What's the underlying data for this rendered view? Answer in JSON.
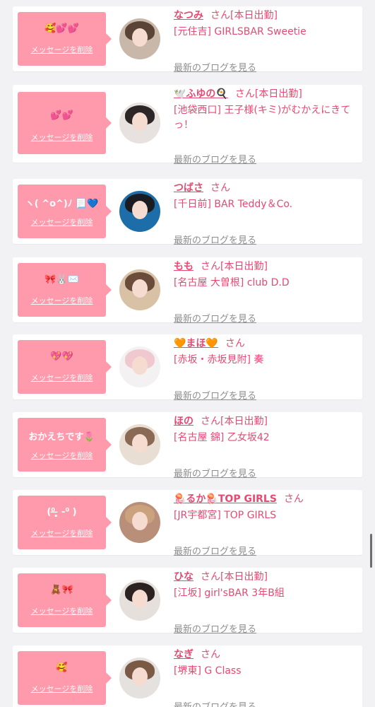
{
  "colors": {
    "accent": "#e54a72",
    "bubble": "#fe9aab",
    "background": "#f2f2f4",
    "muted": "#8e8e8e"
  },
  "common": {
    "delete_label": "メッセージを削除",
    "blog_label": "最新のブログを見る",
    "san": "さん"
  },
  "cards": [
    {
      "message": "🥰💕💕",
      "name": "なつみ",
      "status": "[本日出勤]",
      "shop": "[元住吉] GIRLSBAR Sweetie"
    },
    {
      "message": "💕💕",
      "name": "🕊️ふゆの🍳",
      "status": "[本日出勤]",
      "shop": "[池袋西口] 王子様(キミ)がむかえにきてっ！"
    },
    {
      "message": "ヽ( ^o^)ﾉ 📃💙",
      "name": "つばさ",
      "status": "",
      "shop": "[千日前] BAR Teddy＆Co."
    },
    {
      "message": "🎀🐰✉️",
      "name": "もも",
      "status": "[本日出勤]",
      "shop": "[名古屋 大曽根] club D.D"
    },
    {
      "message": "💖💖",
      "name": "🧡まほ🧡",
      "status": "",
      "shop": "[赤坂・赤坂見附] 奏"
    },
    {
      "message": "おかえちです🌷",
      "name": "ほの",
      "status": "[本日出勤]",
      "shop": "[名古屋 錦] 乙女坂42"
    },
    {
      "message": "(⁰ ̶̥̥̥ -⁰ )",
      "name": "🪼るか🪼TOP GIRLS",
      "status": "",
      "shop": "[JR宇都宮] TOP GIRLS"
    },
    {
      "message": "🧸🎀",
      "name": "ひな",
      "status": "[本日出勤]",
      "shop": "[江坂] girl'sBAR 3年B組"
    },
    {
      "message": "🥰",
      "name": "なぎ",
      "status": "",
      "shop": "[堺東] G Class"
    }
  ]
}
